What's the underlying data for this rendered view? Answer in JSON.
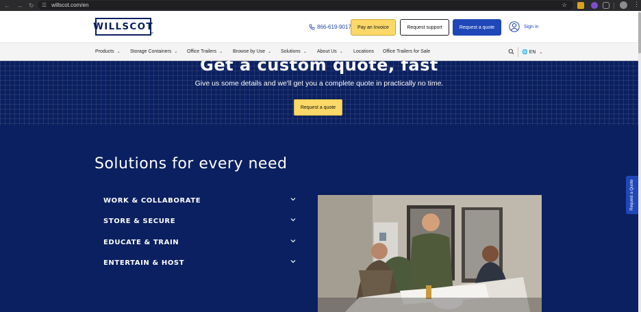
{
  "browser": {
    "url": "willscot.com/en",
    "icons": [
      "back-icon",
      "forward-icon",
      "reload-icon",
      "site-info-icon",
      "bookmark-star-icon",
      "extension-icon",
      "profile-icon",
      "menu-icon"
    ]
  },
  "header": {
    "logo_text": "WILLSCOT",
    "phone": "866-619-9017",
    "pay_invoice": "Pay an Invoice",
    "request_support": "Request support",
    "request_quote": "Request a quote",
    "sign_in": "Sign in"
  },
  "nav": {
    "items": [
      {
        "label": "Products"
      },
      {
        "label": "Storage Containers"
      },
      {
        "label": "Office Trailers"
      },
      {
        "label": "Browse by Use"
      },
      {
        "label": "Solutions"
      },
      {
        "label": "About Us"
      },
      {
        "label": "Locations"
      },
      {
        "label": "Office Trailers for Sale"
      }
    ],
    "language": "EN"
  },
  "hero": {
    "title": "Get a custom quote, fast",
    "subtitle": "Give us some details and we'll get you a complete quote in practically no time.",
    "button": "Request a quote"
  },
  "solutions": {
    "title": "Solutions for every need",
    "items": [
      {
        "label": "WORK & COLLABORATE"
      },
      {
        "label": "STORE & SECURE"
      },
      {
        "label": "EDUCATE & TRAIN"
      },
      {
        "label": "ENTERTAIN & HOST"
      }
    ]
  },
  "side_tab": "Request a Quote",
  "colors": {
    "navy": "#0b2060",
    "accent_blue": "#1f47b8",
    "yellow": "#fbd867"
  }
}
